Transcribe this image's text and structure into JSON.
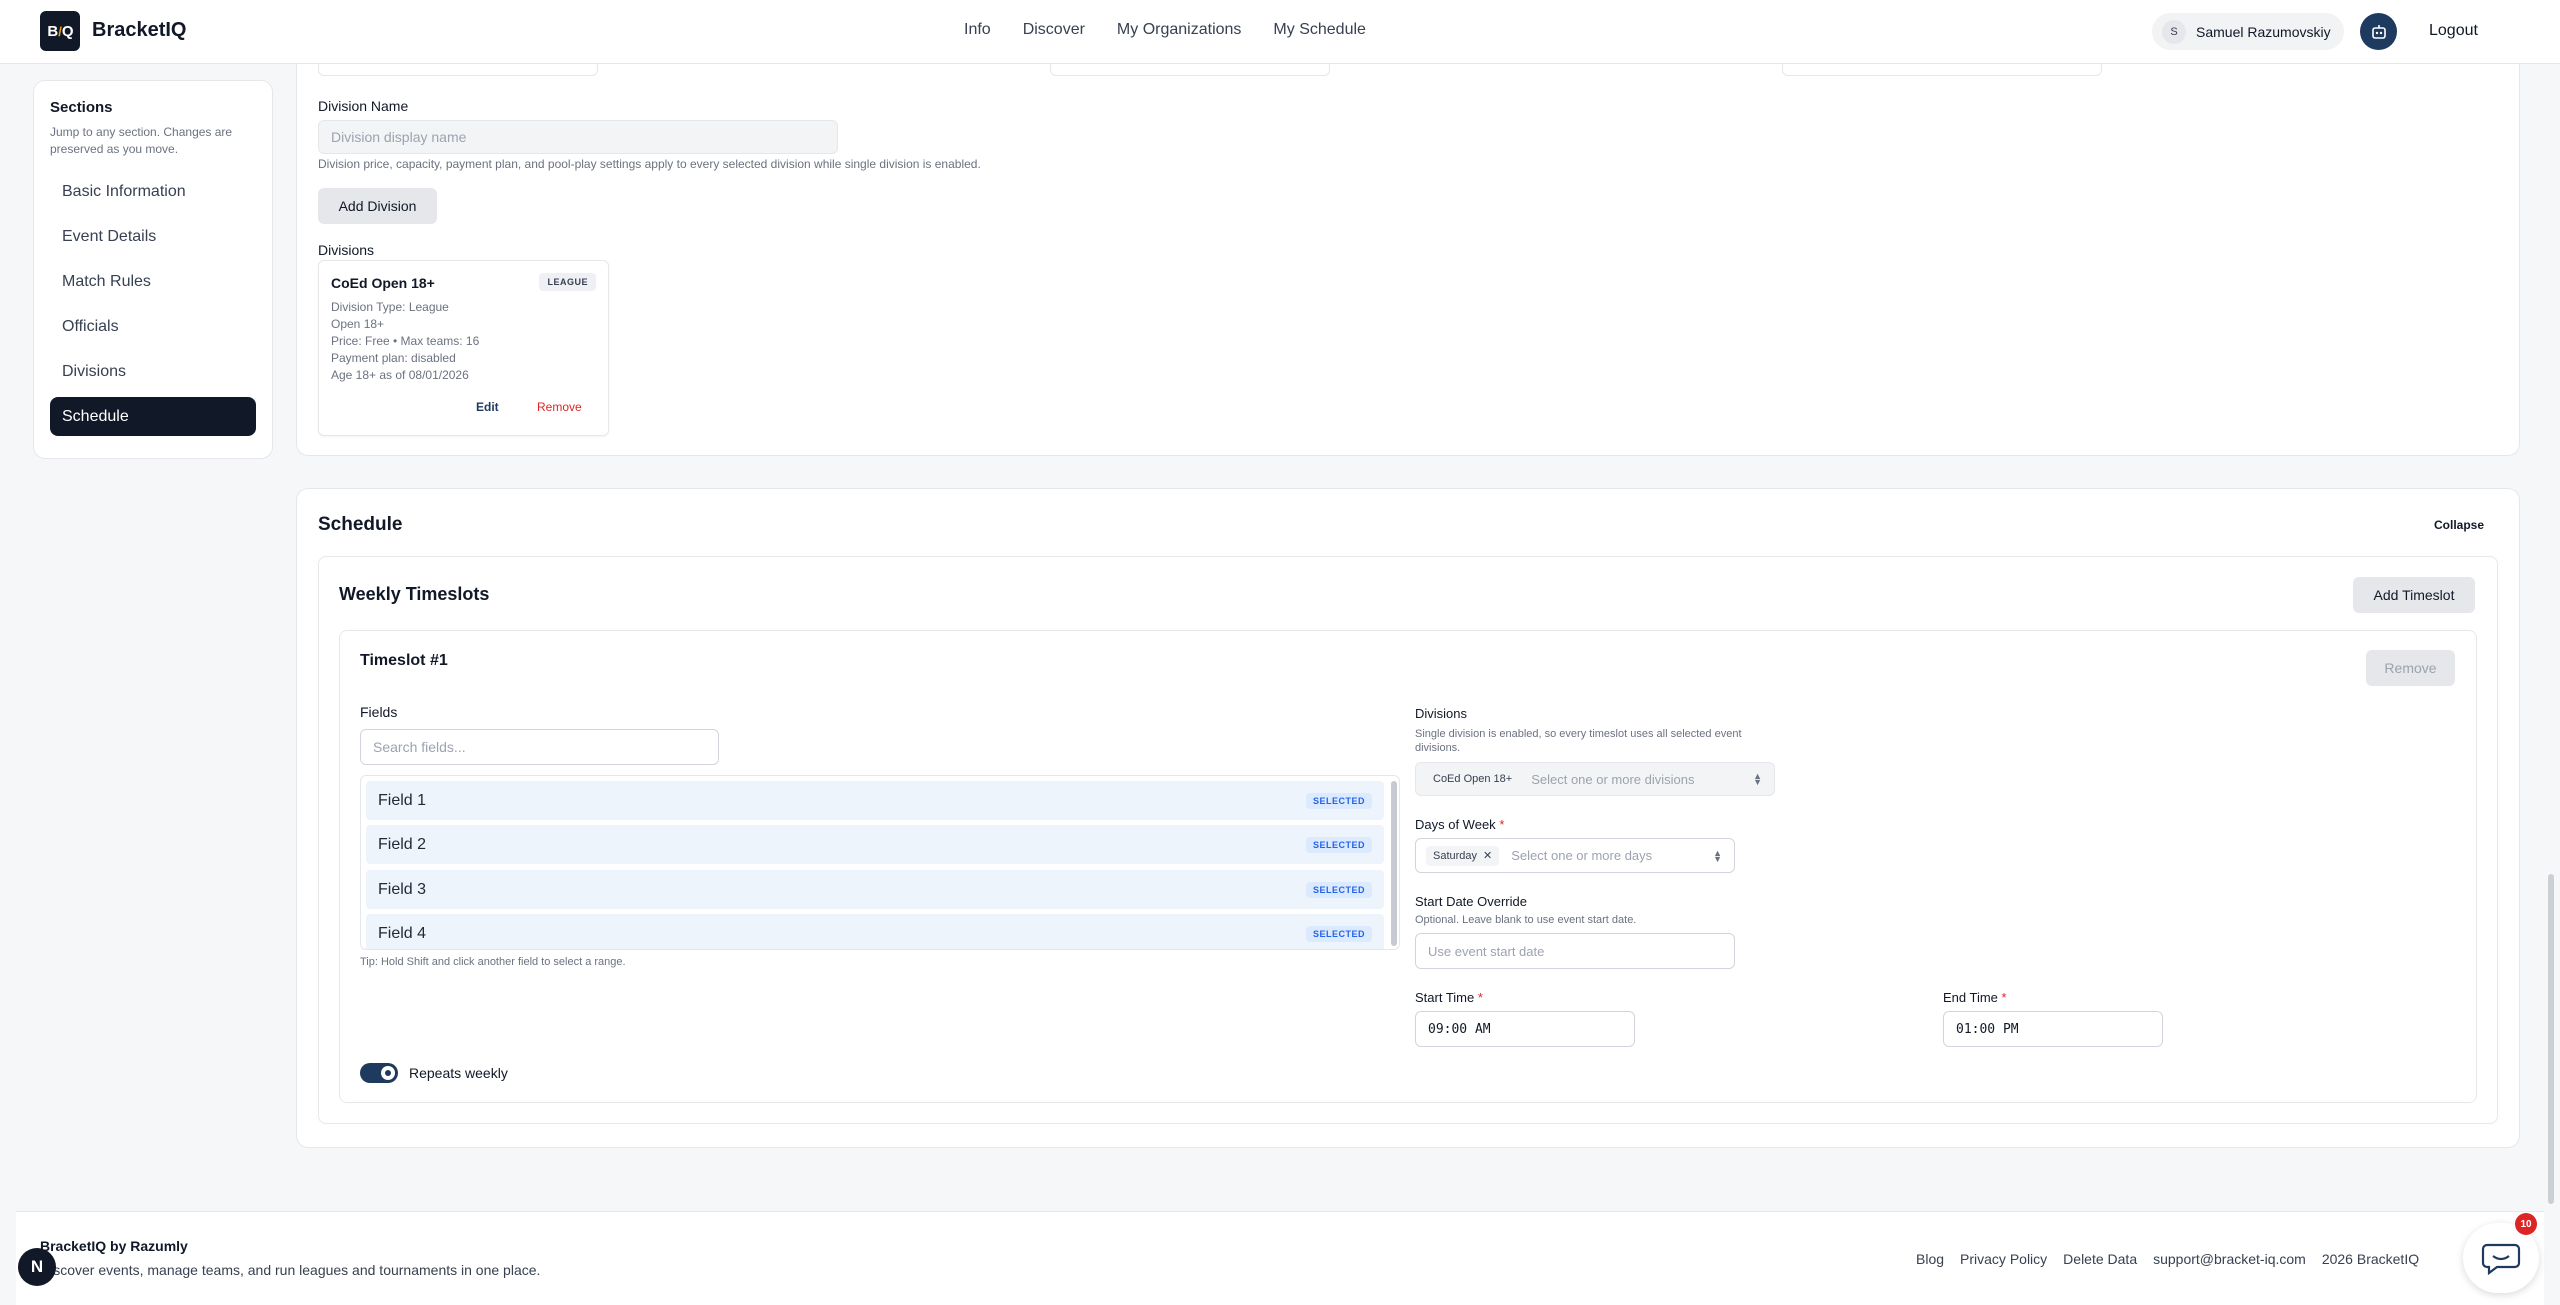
{
  "header": {
    "logo_text": "BQ",
    "brand": "BracketIQ",
    "nav": [
      "Info",
      "Discover",
      "My Organizations",
      "My Schedule"
    ],
    "user_initial": "S",
    "user_name": "Samuel Razumovskiy",
    "logout": "Logout",
    "bot_icon": "robot-icon"
  },
  "sidebar": {
    "title": "Sections",
    "description": "Jump to any section. Changes are preserved as you move.",
    "items": [
      "Basic Information",
      "Event Details",
      "Match Rules",
      "Officials",
      "Divisions",
      "Schedule"
    ],
    "active_item": "Schedule"
  },
  "divisions_section": {
    "division_name_label": "Division Name",
    "division_name_placeholder": "Division display name",
    "help_text": "Division price, capacity, payment plan, and pool-play settings apply to every selected division while single division is enabled.",
    "add_division_button": "Add Division",
    "divisions_label": "Divisions",
    "card": {
      "title": "CoEd Open 18+",
      "badge": "LEAGUE",
      "lines": [
        "Division Type: League",
        "Open 18+",
        "Price: Free • Max teams: 16",
        "Payment plan: disabled",
        "Age 18+ as of 08/01/2026"
      ],
      "edit": "Edit",
      "remove": "Remove"
    }
  },
  "schedule": {
    "title": "Schedule",
    "collapse": "Collapse",
    "weekly_title": "Weekly Timeslots",
    "add_timeslot": "Add Timeslot",
    "timeslot": {
      "title": "Timeslot #1",
      "remove": "Remove",
      "fields_label": "Fields",
      "fields_search_placeholder": "Search fields...",
      "fields": [
        {
          "label": "Field 1",
          "badge": "SELECTED"
        },
        {
          "label": "Field 2",
          "badge": "SELECTED"
        },
        {
          "label": "Field 3",
          "badge": "SELECTED"
        },
        {
          "label": "Field 4",
          "badge": "SELECTED"
        }
      ],
      "fields_tip": "Tip: Hold Shift and click another field to select a range.",
      "repeats_label": "Repeats weekly",
      "repeats_on": true,
      "divisions_label": "Divisions",
      "divisions_help": "Single division is enabled, so every timeslot uses all selected event divisions.",
      "divisions_chip": "CoEd Open 18+",
      "divisions_placeholder": "Select one or more divisions",
      "days_label": "Days of Week",
      "days_chip": "Saturday",
      "days_placeholder": "Select one or more days",
      "start_date_label": "Start Date Override",
      "start_date_help": "Optional. Leave blank to use event start date.",
      "start_date_placeholder": "Use event start date",
      "start_time_label": "Start Time",
      "start_time_value": "09:00 AM",
      "end_time_label": "End Time",
      "end_time_value": "01:00 PM",
      "required_mark": "*"
    }
  },
  "footer": {
    "brand": "BracketIQ by Razumly",
    "tagline": "Discover events, manage teams, and run leagues and tournaments in one place.",
    "links": [
      "Blog",
      "Privacy Policy",
      "Delete Data",
      "support@bracket-iq.com",
      "2026 BracketIQ"
    ],
    "n_badge": "N",
    "chat_count": "10"
  },
  "colors": {
    "accent": "#1e3a5f",
    "active_nav": "#111827",
    "danger": "#dc2626",
    "selected_row": "#eef4fb"
  }
}
